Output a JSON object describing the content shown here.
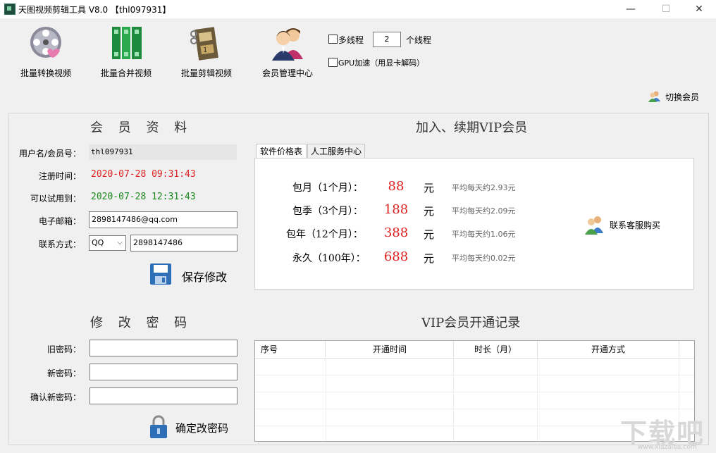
{
  "window": {
    "title": "天图视频剪辑工具 V8.0  【thl097931】",
    "minimize": "—",
    "maximize": "☐",
    "close": "✕"
  },
  "toolbar": {
    "items": [
      {
        "label": "批量转换视频",
        "icon": "film-reel-icon"
      },
      {
        "label": "批量合并视频",
        "icon": "merge-bars-icon"
      },
      {
        "label": "批量剪辑视频",
        "icon": "film-cut-icon"
      },
      {
        "label": "会员管理中心",
        "icon": "members-icon"
      }
    ],
    "multithread_label": "多线程",
    "thread_count": "2",
    "thread_unit": "个线程",
    "gpu_label": "GPU加速（用显卡解码）",
    "switch_member": "切换会员"
  },
  "profile": {
    "title": "会 员 资 料",
    "username_label": "用户名/会员号：",
    "username": "thl097931",
    "reg_label": "注册时间：",
    "reg_time": "2020-07-28 09:31:43",
    "trial_label": "可以试用到：",
    "trial_time": "2020-07-28 12:31:43",
    "email_label": "电子邮箱：",
    "email": "2898147486@qq.com",
    "contact_label": "联系方式：",
    "contact_type": "QQ",
    "contact_value": "2898147486",
    "save_label": "保存修改"
  },
  "vip": {
    "title": "加入、续期VIP会员",
    "tabs": [
      "软件价格表",
      "人工服务中心"
    ],
    "plans": [
      {
        "name": "包月（1个月）：",
        "price": "88",
        "unit": "元",
        "avg": "平均每天约2.93元"
      },
      {
        "name": "包季（3个月）：",
        "price": "188",
        "unit": "元",
        "avg": "平均每天约2.09元"
      },
      {
        "name": "包年（12个月）：",
        "price": "388",
        "unit": "元",
        "avg": "平均每天约1.06元"
      },
      {
        "name": "永久（100年）：",
        "price": "688",
        "unit": "元",
        "avg": "平均每天约0.02元"
      }
    ],
    "contact_buy": "联系客服购买"
  },
  "password": {
    "title": "修 改 密 码",
    "old_label": "旧密码：",
    "new_label": "新密码：",
    "confirm_label": "确认新密码：",
    "submit_label": "确定改密码"
  },
  "records": {
    "title": "VIP会员开通记录",
    "columns": [
      "序号",
      "开通时间",
      "时长（月）",
      "开通方式"
    ]
  },
  "colors": {
    "red": "#e02020",
    "green": "#1a8a1a",
    "background": "#f0f0f0"
  }
}
